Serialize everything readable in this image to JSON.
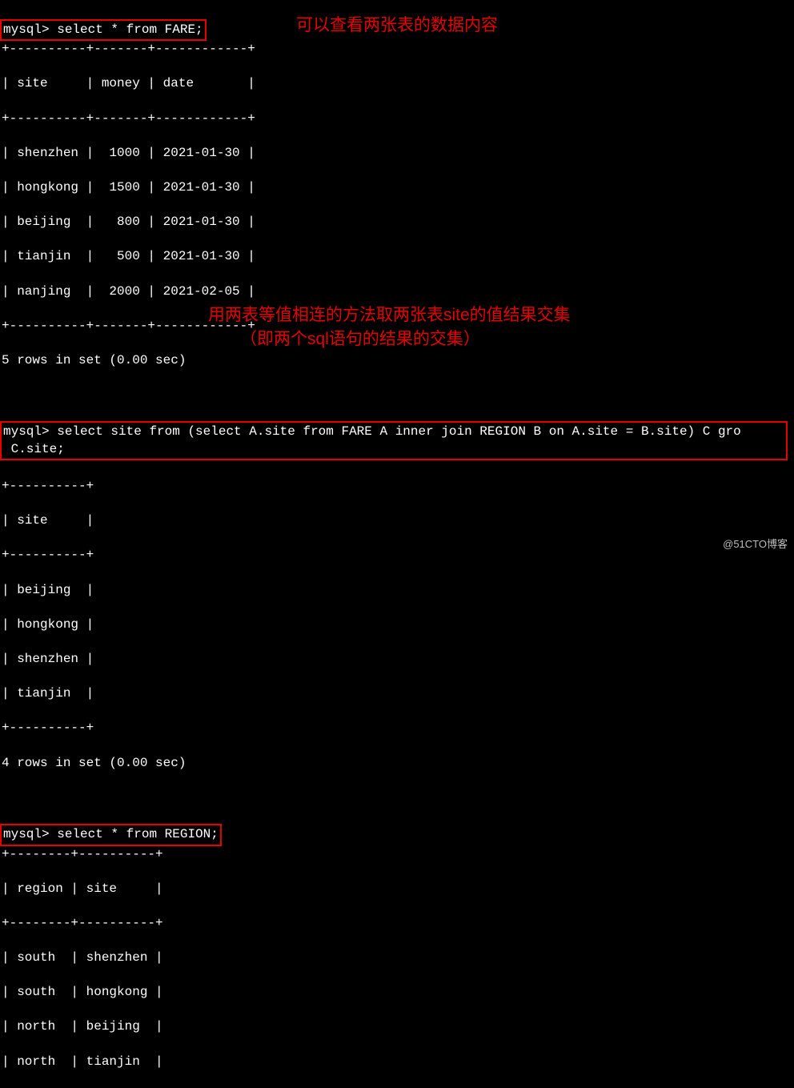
{
  "prompt": "mysql>",
  "queries": {
    "q1": "select * from FARE;",
    "q2_line1": "select site from (select A.site from FARE A inner join REGION B on A.site = B.site) C gro",
    "q2_line2": " C.site;",
    "q3": "select * from REGION;"
  },
  "fare_table": {
    "sep": "+----------+-------+------------+",
    "header": "| site     | money | date       |",
    "rows": [
      "| shenzhen |  1000 | 2021-01-30 |",
      "| hongkong |  1500 | 2021-01-30 |",
      "| beijing  |   800 | 2021-01-30 |",
      "| tianjin  |   500 | 2021-01-30 |",
      "| nanjing  |  2000 | 2021-02-05 |"
    ],
    "footer": "5 rows in set (0.00 sec)"
  },
  "site_table": {
    "sep": "+----------+",
    "header": "| site     |",
    "rows": [
      "| beijing  |",
      "| hongkong |",
      "| shenzhen |",
      "| tianjin  |"
    ],
    "footer": "4 rows in set (0.00 sec)"
  },
  "region_table": {
    "sep": "+--------+----------+",
    "header": "| region | site     |",
    "rows": [
      "| south  | shenzhen |",
      "| south  | hongkong |",
      "| north  | beijing  |",
      "| north  | tianjin  |"
    ]
  },
  "annotations": {
    "a1": "可以查看两张表的数据内容",
    "a2": "用两表等值相连的方法取两张表site的值结果交集",
    "a3": "（即两个sql语句的结果的交集）"
  },
  "watermark": "@51CTO博客",
  "colors": {
    "highlight": "#e60000",
    "bg": "#000000",
    "fg": "#ffffff"
  }
}
